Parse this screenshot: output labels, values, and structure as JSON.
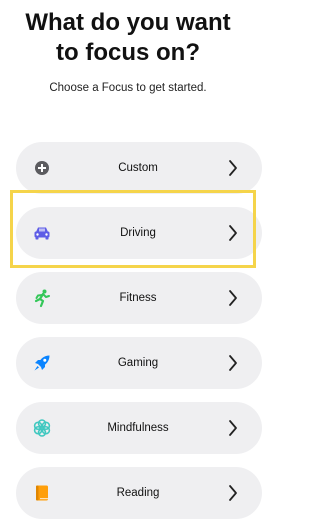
{
  "header": {
    "title_line1": "What do you want",
    "title_line2": "to focus on?",
    "subtitle": "Choose a Focus to get started."
  },
  "focus_options": [
    {
      "label": "Custom",
      "icon": "plus-circle-icon",
      "icon_color": "#5b5b5f"
    },
    {
      "label": "Driving",
      "icon": "car-icon",
      "icon_color": "#5e5ce6"
    },
    {
      "label": "Fitness",
      "icon": "running-figure-icon",
      "icon_color": "#34c759"
    },
    {
      "label": "Gaming",
      "icon": "rocket-icon",
      "icon_color": "#0a84ff"
    },
    {
      "label": "Mindfulness",
      "icon": "flower-icon",
      "icon_color": "#40c8c0"
    },
    {
      "label": "Reading",
      "icon": "book-icon",
      "icon_color": "#ff9f0a"
    }
  ],
  "highlight_color": "#f5d44a"
}
